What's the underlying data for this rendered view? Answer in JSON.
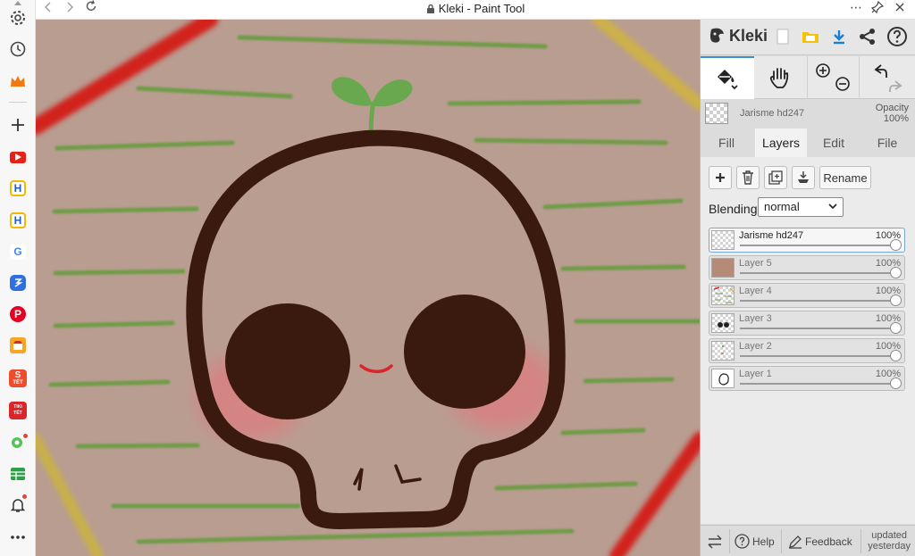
{
  "window": {
    "title": "Kleki - Paint Tool"
  },
  "browser": {
    "sidebar_items": [
      {
        "name": "settings-icon"
      },
      {
        "name": "history-icon"
      },
      {
        "name": "crown-icon"
      },
      {
        "name": "add-icon"
      },
      {
        "name": "youtube-icon"
      },
      {
        "name": "h-app-icon"
      },
      {
        "name": "h-app-icon-2"
      },
      {
        "name": "google-icon"
      },
      {
        "name": "translate-icon"
      },
      {
        "name": "pinterest-icon"
      },
      {
        "name": "store-icon"
      },
      {
        "name": "shopee-icon"
      },
      {
        "name": "tiki-icon"
      },
      {
        "name": "games-icon"
      },
      {
        "name": "sheet-icon"
      },
      {
        "name": "bell-icon"
      },
      {
        "name": "more-icon"
      }
    ],
    "badges": {
      "shopee": "TẾT",
      "tiki": "TIKI TẾT",
      "google": "G"
    }
  },
  "app": {
    "brand": "Kleki",
    "colors": {
      "accent": "#3a8ed6",
      "canvas_bg": "#b99d91",
      "panel_bg": "#dcdcdc"
    },
    "layer_info": {
      "name": "Jarisme hd247",
      "opacity_label": "Opacity",
      "opacity_value": "100%"
    },
    "tabs": [
      {
        "label": "Fill",
        "active": false
      },
      {
        "label": "Layers",
        "active": true
      },
      {
        "label": "Edit",
        "active": false
      },
      {
        "label": "File",
        "active": false
      }
    ],
    "layer_buttons": {
      "rename": "Rename"
    },
    "blending": {
      "label": "Blending",
      "value": "normal"
    },
    "layers": [
      {
        "name": "Jarisme hd247",
        "opacity": "100%",
        "active": true
      },
      {
        "name": "Layer 5",
        "opacity": "100%",
        "active": false
      },
      {
        "name": "Layer 4",
        "opacity": "100%",
        "active": false
      },
      {
        "name": "Layer 3",
        "opacity": "100%",
        "active": false
      },
      {
        "name": "Layer 2",
        "opacity": "100%",
        "active": false
      },
      {
        "name": "Layer 1",
        "opacity": "100%",
        "active": false
      }
    ],
    "bottom_bar": {
      "help": "Help",
      "feedback": "Feedback",
      "updated_line1": "updated",
      "updated_line2": "yesterday"
    }
  }
}
